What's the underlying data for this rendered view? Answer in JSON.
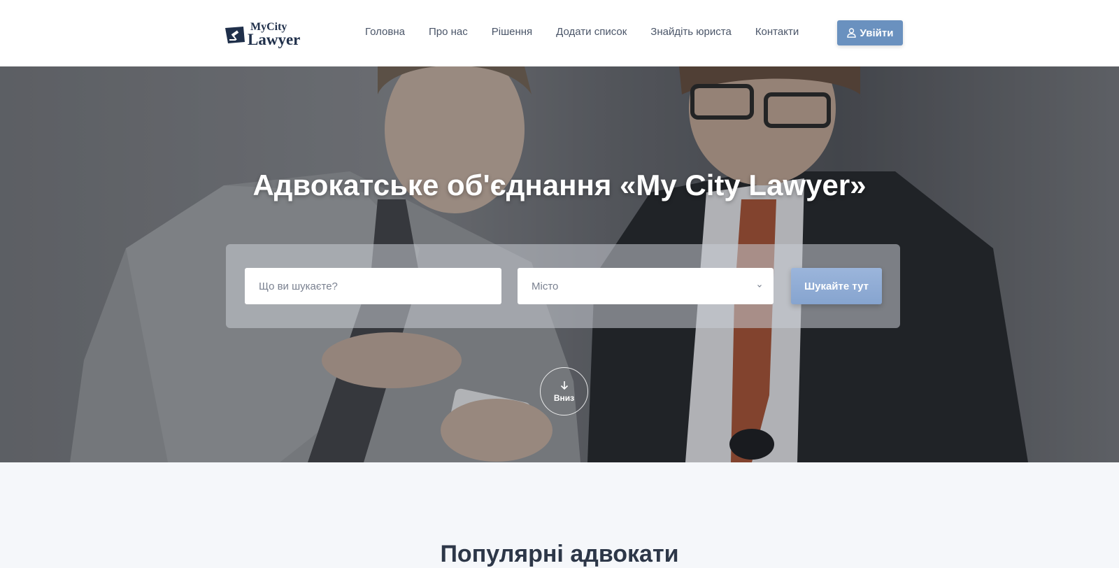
{
  "header": {
    "logo": {
      "top": "MyCity",
      "bottom": "Lawyer"
    },
    "nav": [
      {
        "label": "Головна"
      },
      {
        "label": "Про нас"
      },
      {
        "label": "Рішення"
      },
      {
        "label": "Додати список"
      },
      {
        "label": "Знайдіть юриста"
      },
      {
        "label": "Контакти"
      }
    ],
    "login": {
      "label": "Увійти",
      "icon": "user-icon"
    }
  },
  "hero": {
    "title": "Адвокатське об'єднання «My City Lawyer»",
    "search": {
      "query_placeholder": "Що ви шукаєте?",
      "city_selected": "Місто",
      "button_label": "Шукайте тут"
    },
    "scroll": {
      "label": "Вниз",
      "icon": "arrow-down-icon"
    }
  },
  "section": {
    "title": "Популярні адвокати"
  },
  "colors": {
    "accent": "#6a91bf",
    "search_button": "#8aa7d1",
    "text_dark": "#2d3748",
    "nav_text": "#4a5568"
  }
}
